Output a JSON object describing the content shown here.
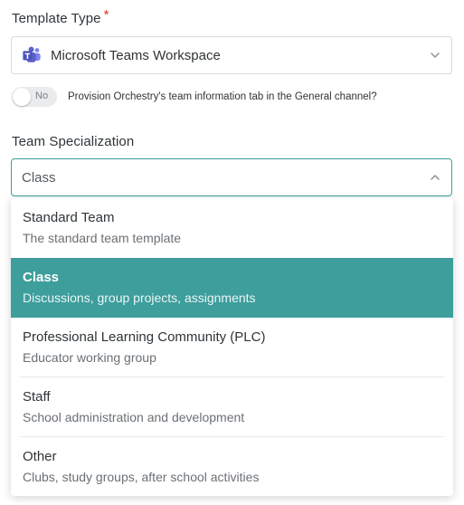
{
  "template_type": {
    "label": "Template Type",
    "required_marker": "*",
    "selected_value": "Microsoft Teams Workspace",
    "icon": "microsoft-teams-icon"
  },
  "provision_toggle": {
    "state_label": "No",
    "is_on": false,
    "text": "Provision Orchestry's team information tab in the General channel?"
  },
  "team_specialization": {
    "label": "Team Specialization",
    "input_value": "Class",
    "expanded": true,
    "options": [
      {
        "title": "Standard Team",
        "description": "The standard team template",
        "selected": false
      },
      {
        "title": "Class",
        "description": "Discussions, group projects, assignments",
        "selected": true
      },
      {
        "title": "Professional Learning Community (PLC)",
        "description": "Educator working group",
        "selected": false
      },
      {
        "title": "Staff",
        "description": "School administration and development",
        "selected": false
      },
      {
        "title": "Other",
        "description": "Clubs, study groups, after school activities",
        "selected": false
      }
    ]
  },
  "colors": {
    "accent": "#3d9e9c",
    "required": "#d93025",
    "teams_purple": "#5b5fc7"
  }
}
